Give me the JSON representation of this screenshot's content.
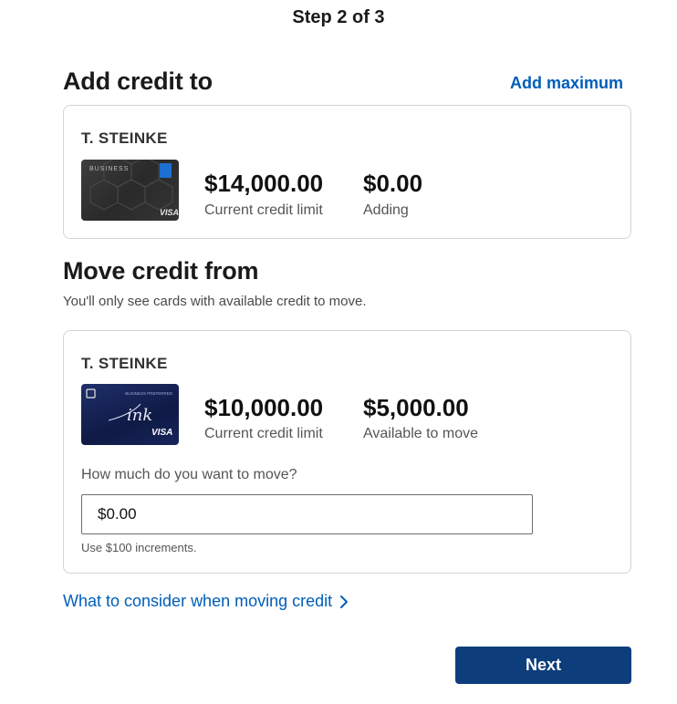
{
  "header": {
    "step": "Step 2 of 3"
  },
  "add_section": {
    "title": "Add credit to",
    "add_max_label": "Add maximum",
    "card": {
      "holder": "T. STEINKE",
      "card_image_text": "BUSINESS",
      "card_network": "VISA",
      "current_limit": "$14,000.00",
      "current_limit_label": "Current credit limit",
      "adding": "$0.00",
      "adding_label": "Adding"
    }
  },
  "move_section": {
    "title": "Move credit from",
    "subtitle": "You'll only see cards with available credit to move.",
    "card": {
      "holder": "T. STEINKE",
      "card_image_text": "BUSINESS PREFERRED",
      "card_brand": "ink",
      "card_network": "VISA",
      "current_limit": "$10,000.00",
      "current_limit_label": "Current credit limit",
      "available": "$5,000.00",
      "available_label": "Available to move"
    },
    "question": "How much do you want to move?",
    "input_value": "$0.00",
    "hint": "Use $100 increments."
  },
  "consider_link": "What to consider when moving credit",
  "next_label": "Next",
  "colors": {
    "link": "#005eb8",
    "primary_button": "#0d3d7a",
    "border": "#d4d4d4"
  },
  "icons": {
    "consider": "chevron-right-icon",
    "chase": "chase-logo-icon"
  }
}
